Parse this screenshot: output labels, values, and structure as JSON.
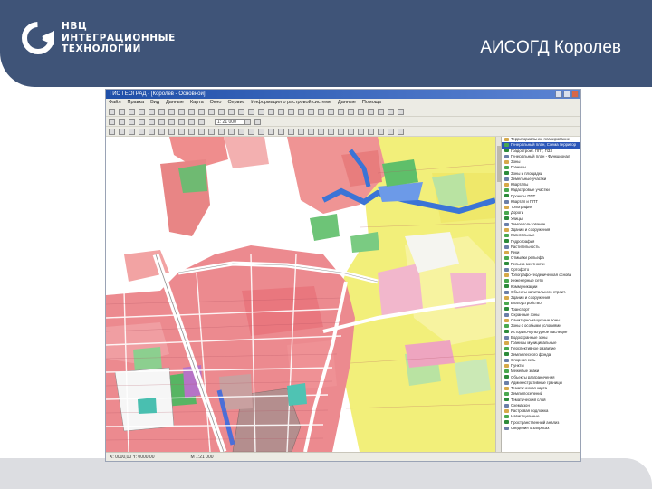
{
  "slide": {
    "title": "АИСОГД Королев",
    "logo": {
      "company_lines": [
        "НВЦ",
        "ИНТЕГРАЦИОННЫЕ",
        "ТЕХНОЛОГИИ"
      ],
      "mark_color": "#ffffff"
    },
    "colors": {
      "header": "#3f5478",
      "bottom_bar": "#dcdde1"
    }
  },
  "app": {
    "title": "ГИС ГЕОГРАД - [Королев - Основной]",
    "menu": [
      "Файл",
      "Правка",
      "Вид",
      "Данные",
      "Карта",
      "Окно",
      "Сервис",
      "Информация о растровой системе",
      "Данные",
      "Помощь"
    ],
    "zoom_value": "1: 21 000",
    "status_left": "Х: 0000,00 Y: 0000,00",
    "status_right": "М 1:21 000"
  },
  "layers": {
    "items": [
      "Территориальное планирование",
      "Генеральный план, Схема территор",
      "Градостроит. ППТ, ПЗЗ",
      "Генеральный план - Функционал",
      "Зоны",
      "Границы",
      "Зоны и площадки",
      "Земельные участки",
      "Кварталы",
      "Кадастровые участки",
      "Проекты ППТ",
      "Квартал и ППТ",
      "Топография",
      "Дороги",
      "Улицы",
      "Землепользование",
      "Здания и сооружения",
      "Капитальные",
      "Гидрография",
      "Растительность",
      "Реки",
      "Отмывки рельефа",
      "Рельеф местности",
      "Ортофото",
      "Топографо-геодезическая основа",
      "Инженерные сети",
      "Коммуникации",
      "Объекты капитального строит.",
      "Здания и сооружения",
      "Благоустройство",
      "Транспорт",
      "Охранные зоны",
      "Санитарно-защитные зоны",
      "Зоны с особыми условиями",
      "Историко-культурное наследие",
      "Водоохранные зоны",
      "Границы муниципальные",
      "Перспективное развитие",
      "Земли лесного фонда",
      "Опорная сеть",
      "Пункты",
      "Межевые знаки",
      "Объекты разграничения",
      "Административные границы",
      "Тематическая карта",
      "Земли поселений",
      "Тематический слой",
      "Схема зон",
      "Растровая подложка",
      "Навигационные",
      "Пространственный анализ",
      "Сведения о запросах"
    ],
    "selected_index": 1
  }
}
